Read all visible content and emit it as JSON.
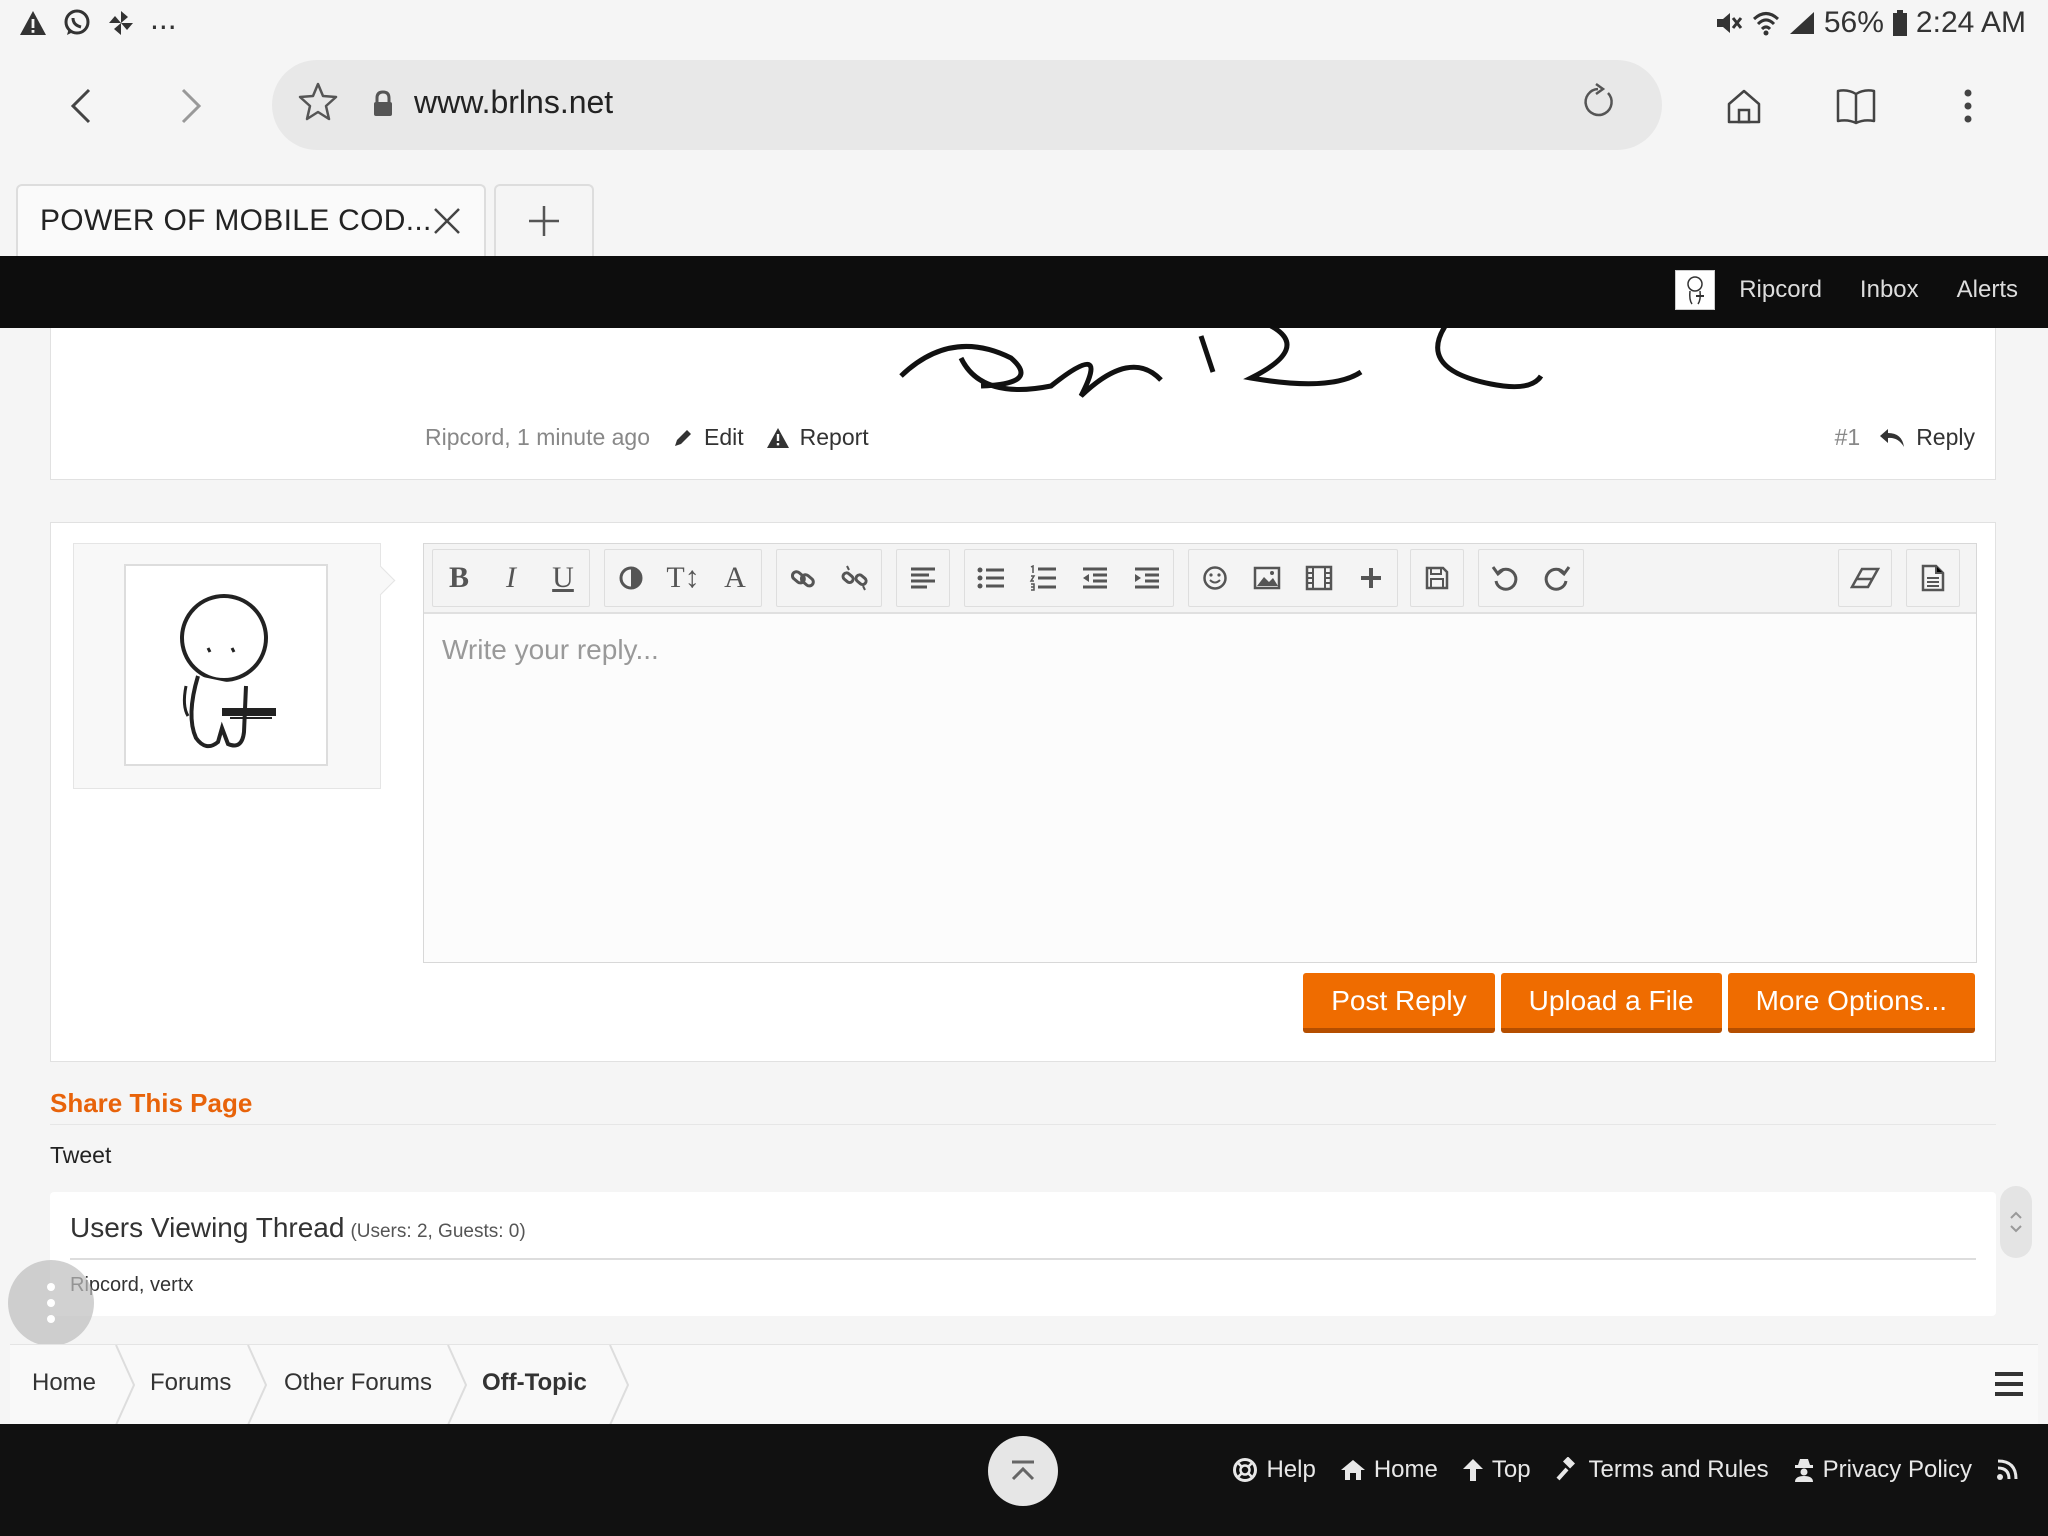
{
  "status_bar": {
    "battery": "56%",
    "time": "2:24 AM",
    "more": "..."
  },
  "browser": {
    "url": "www.brlns.net",
    "tab_title": "POWER OF MOBILE COD..."
  },
  "site_topbar": {
    "user": "Ripcord",
    "inbox": "Inbox",
    "alerts": "Alerts"
  },
  "post": {
    "meta": "Ripcord, 1 minute ago",
    "edit": "Edit",
    "report": "Report",
    "number": "#1",
    "reply": "Reply"
  },
  "reply_editor": {
    "placeholder": "Write your reply...",
    "toolbar_text": {
      "bold": "B",
      "italic": "I",
      "underline": "U",
      "font_size": "T↕",
      "font_family": "A"
    },
    "buttons": {
      "post_reply": "Post Reply",
      "upload": "Upload a File",
      "more_options": "More Options..."
    }
  },
  "share": {
    "title": "Share This Page",
    "tweet": "Tweet"
  },
  "viewers": {
    "title": "Users Viewing Thread",
    "count": "(Users: 2, Guests: 0)",
    "names": "Ripcord, vertx"
  },
  "breadcrumb": [
    "Home",
    "Forums",
    "Other Forums",
    "Off-Topic"
  ],
  "footer": {
    "help": "Help",
    "home": "Home",
    "top": "Top",
    "terms": "Terms and Rules",
    "privacy": "Privacy Policy"
  },
  "colors": {
    "accent": "#ef6c00",
    "share_title": "#e8630a",
    "topbar": "#0d0d0d"
  }
}
